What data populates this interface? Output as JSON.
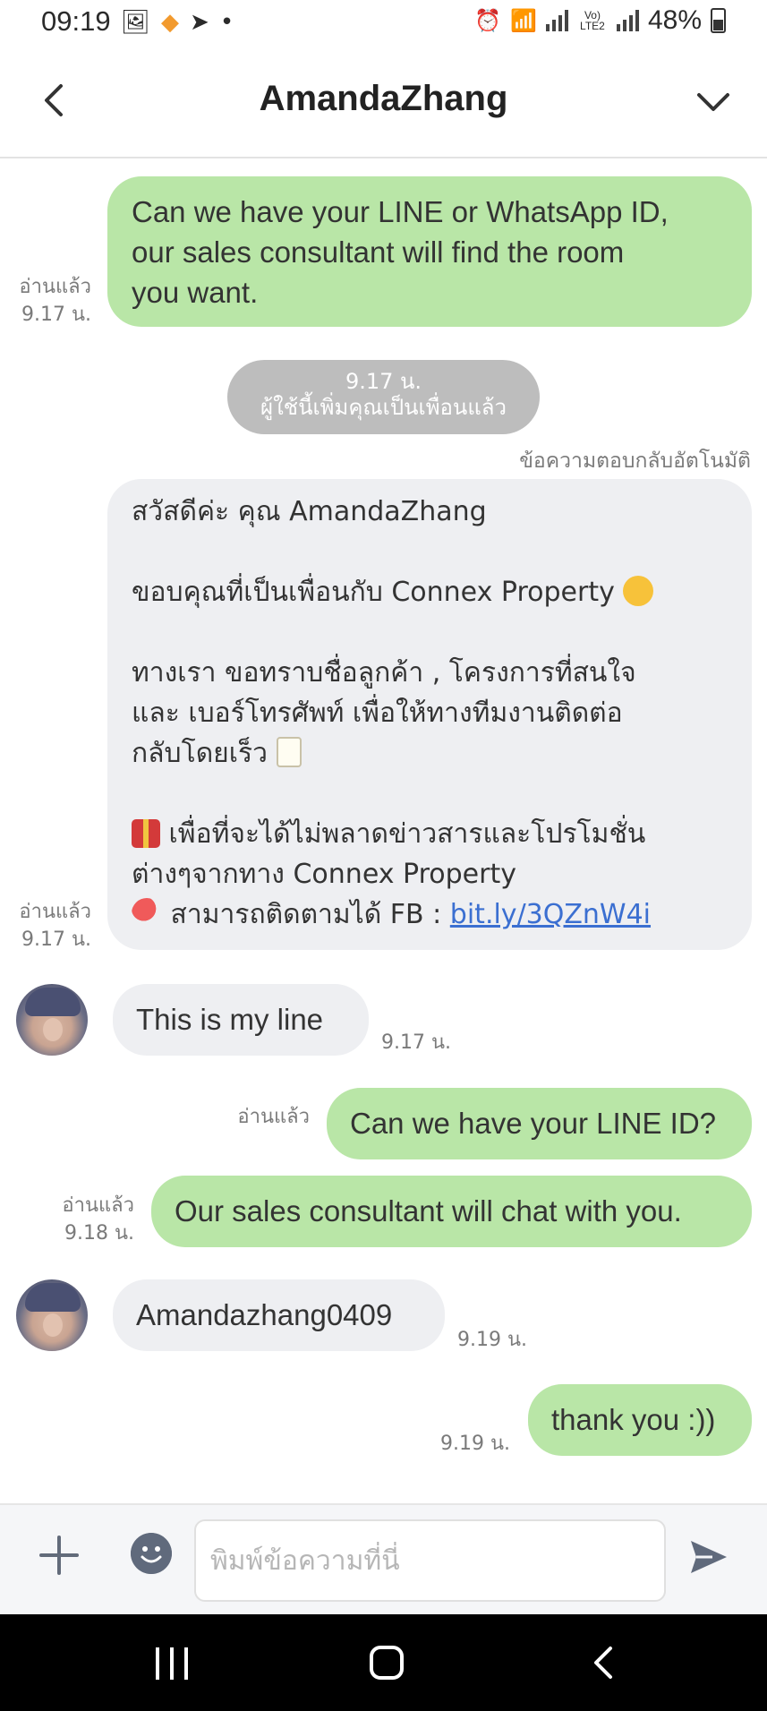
{
  "status_bar": {
    "time": "09:19",
    "battery": "48%",
    "network_label": "Vo) LTE2"
  },
  "header": {
    "title": "AmandaZhang",
    "back_icon": "chevron-left-icon",
    "menu_icon": "chevron-down-icon"
  },
  "messages": {
    "m1": {
      "lines": [
        "Can we have your LINE or WhatsApp ID,",
        "our sales consultant will find the room",
        "you want."
      ],
      "read": "อ่านแล้ว",
      "time": "9.17 น."
    },
    "system": {
      "time": "9.17 น.",
      "text": "ผู้ใช้นี้เพิ่มคุณเป็นเพื่อนแล้ว"
    },
    "auto_reply_label": "ข้อความตอบกลับอัตโนมัติ",
    "m2": {
      "line1": "สวัสดีค่ะ คุณ AmandaZhang",
      "line2": "ขอบคุณที่เป็นเพื่อนกับ Connex Property",
      "line3": "ทางเรา ขอทราบชื่อลูกค้า , โครงการที่สนใจ",
      "line4": "และ เบอร์โทรศัพท์ เพื่อให้ทางทีมงานติดต่อ",
      "line5": "กลับโดยเร็ว",
      "line6": "เพื่อที่จะได้ไม่พลาดข่าวสารและโปรโมชั่น",
      "line7": "ต่างๆจากทาง Connex Property",
      "line8": "สามารถติดตามได้ FB : ",
      "link": "bit.ly/3QZnW4i",
      "read": "อ่านแล้ว",
      "time": "9.17 น."
    },
    "m3": {
      "text": "This is my line",
      "time": "9.17 น."
    },
    "m4": {
      "text": "Can we have your LINE ID?",
      "read": "อ่านแล้ว"
    },
    "m5": {
      "text": "Our sales consultant will chat with you.",
      "read": "อ่านแล้ว",
      "time": "9.18 น."
    },
    "m6": {
      "text": "Amandazhang0409",
      "time": "9.19 น."
    },
    "m7": {
      "text": "thank you :))",
      "time": "9.19 น."
    }
  },
  "input_bar": {
    "placeholder": "พิมพ์ข้อความที่นี่"
  },
  "colors": {
    "my_bubble": "#b9e6a7",
    "their_bubble": "#eeeff2",
    "link": "#3b6fd1",
    "system_pill": "#bdbdbd"
  }
}
